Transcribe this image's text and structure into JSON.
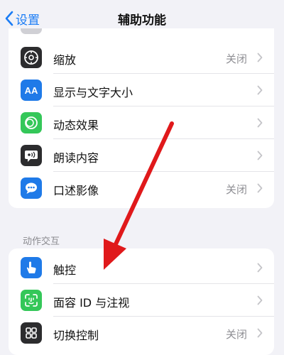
{
  "nav": {
    "back_label": "设置",
    "title": "辅助功能"
  },
  "vision_items": [
    {
      "label": "缩放",
      "value": "关闭",
      "icon": "zoom-icon",
      "color": "#2c2c2e"
    },
    {
      "label": "显示与文字大小",
      "value": "",
      "icon": "text-size-icon",
      "color": "#1f7ae8"
    },
    {
      "label": "动态效果",
      "value": "",
      "icon": "motion-icon",
      "color": "#34c759"
    },
    {
      "label": "朗读内容",
      "value": "",
      "icon": "spoken-content-icon",
      "color": "#2c2c2e"
    },
    {
      "label": "口述影像",
      "value": "关闭",
      "icon": "audio-descriptions-icon",
      "color": "#1f7ae8"
    }
  ],
  "section_header": "动作交互",
  "interaction_items": [
    {
      "label": "触控",
      "value": "",
      "icon": "touch-icon",
      "color": "#1f7ae8"
    },
    {
      "label": "面容 ID 与注视",
      "value": "",
      "icon": "face-id-icon",
      "color": "#34c759"
    },
    {
      "label": "切换控制",
      "value": "关闭",
      "icon": "switch-control-icon",
      "color": "#2c2c2e"
    }
  ],
  "annotation": {
    "arrow_color": "#e0191b"
  }
}
